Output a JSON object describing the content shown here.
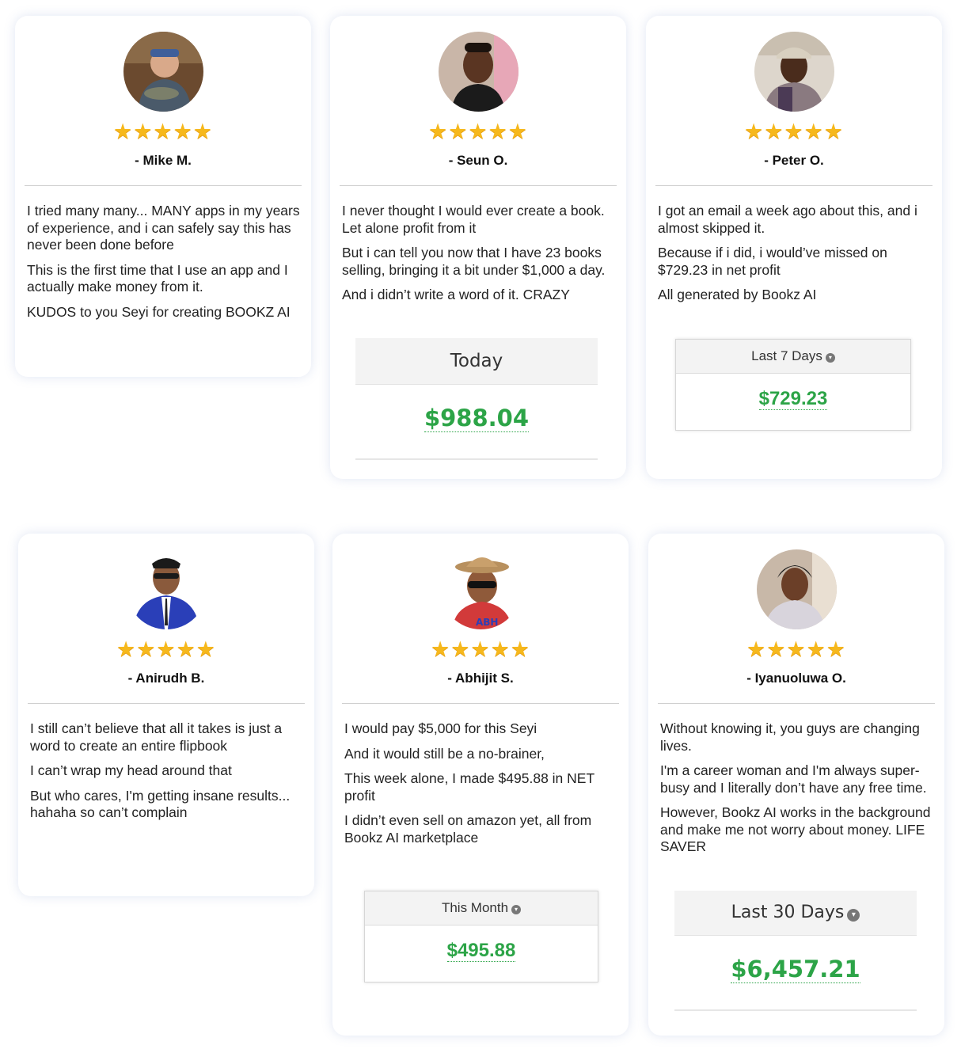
{
  "testimonials": [
    {
      "name": "- Mike M.",
      "stars": "★★★★★",
      "paragraphs": [
        "I tried many many... MANY apps in my years of experience,  and i can safely say this has never been done before",
        "This is the first time that I use an app and I actually make money from it.",
        "KUDOS to you Seyi for creating BOOKZ AI"
      ]
    },
    {
      "name": "- Seun O.",
      "stars": "★★★★★",
      "paragraphs": [
        "I never thought I would ever create a book. Let alone profit from it",
        "But i can tell you now that I have 23 books selling, bringing it a bit under $1,000 a day.",
        "And i didn’t write a word of it. CRAZY"
      ],
      "widget": {
        "label": "Today",
        "value": "$988.04"
      }
    },
    {
      "name": "- Peter O.",
      "stars": "★★★★★",
      "paragraphs": [
        "I got an email a week ago about this, and i almost skipped it.",
        "Because if i did, i would’ve missed on $729.23 in net profit",
        "All generated by Bookz AI"
      ],
      "widget": {
        "label": "Last 7 Days",
        "value": "$729.23"
      }
    },
    {
      "name": "- Anirudh B.",
      "stars": "★★★★★",
      "paragraphs": [
        "I still can’t believe that all it takes is just a word to create an entire flipbook",
        "I can’t wrap my head around that",
        "But who cares, I'm getting insane results... hahaha so can’t complain"
      ]
    },
    {
      "name": "- Abhijit S.",
      "stars": "★★★★★",
      "paragraphs": [
        "I would pay $5,000 for this Seyi",
        "And it would still be a no-brainer,",
        "This week alone, I made $495.88 in NET profit",
        "I didn’t even sell on amazon yet, all from Bookz AI marketplace"
      ],
      "widget": {
        "label": "This Month",
        "value": "$495.88"
      }
    },
    {
      "name": "- Iyanuoluwa O.",
      "stars": "★★★★★",
      "paragraphs": [
        "Without knowing it, you guys are changing lives.",
        "I'm a career woman and I'm always super-busy and I literally don’t have any free time.",
        "However, Bookz AI works in the background and make me not worry about money. LIFE SAVER"
      ],
      "widget": {
        "label": "Last 30 Days",
        "value": "$6,457.21"
      }
    }
  ],
  "icons": {
    "rating": "star-icon",
    "dropdown": "chevron-down-circle-icon"
  },
  "colors": {
    "star": "#f6b81c",
    "money": "#2ca447"
  }
}
